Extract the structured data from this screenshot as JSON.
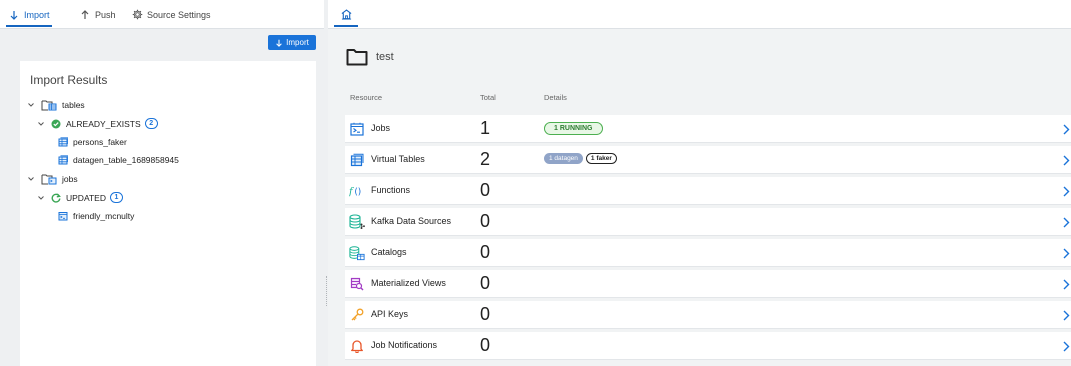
{
  "left": {
    "tabs": [
      {
        "label": "Import",
        "icon": "arrow-down-icon",
        "active": true
      },
      {
        "label": "Push",
        "icon": "arrow-up-icon",
        "active": false
      },
      {
        "label": "Source Settings",
        "icon": "gear-icon",
        "active": false
      }
    ],
    "import_button": {
      "label": "Import",
      "icon": "arrow-down-icon"
    },
    "results": {
      "title": "Import Results",
      "tables": {
        "label": "tables",
        "status": {
          "label": "ALREADY_EXISTS",
          "count": "2"
        },
        "items": [
          "persons_faker",
          "datagen_table_1689858945"
        ]
      },
      "jobs": {
        "label": "jobs",
        "status": {
          "label": "UPDATED",
          "count": "1"
        },
        "items": [
          "friendly_mcnulty"
        ]
      }
    }
  },
  "right": {
    "home_tab_icon": "home-icon",
    "folder_name": "test",
    "columns": {
      "resource": "Resource",
      "total": "Total",
      "details": "Details"
    },
    "rows": [
      {
        "name": "Jobs",
        "total": "1",
        "icon": "jobs-icon",
        "details": {
          "running": "1 RUNNING"
        }
      },
      {
        "name": "Virtual Tables",
        "total": "2",
        "icon": "table-icon",
        "details": {
          "datagen": "1 datagen",
          "faker": "1 faker"
        }
      },
      {
        "name": "Functions",
        "total": "0",
        "icon": "function-icon"
      },
      {
        "name": "Kafka Data Sources",
        "total": "0",
        "icon": "kafka-icon"
      },
      {
        "name": "Catalogs",
        "total": "0",
        "icon": "catalog-icon"
      },
      {
        "name": "Materialized Views",
        "total": "0",
        "icon": "materialized-view-icon"
      },
      {
        "name": "API Keys",
        "total": "0",
        "icon": "key-icon"
      },
      {
        "name": "Job Notifications",
        "total": "0",
        "icon": "bell-icon"
      }
    ]
  },
  "colors": {
    "accent": "#1565c0",
    "button": "#1a73d9",
    "success": "#4caf50",
    "chevron": "#1a73d9"
  }
}
